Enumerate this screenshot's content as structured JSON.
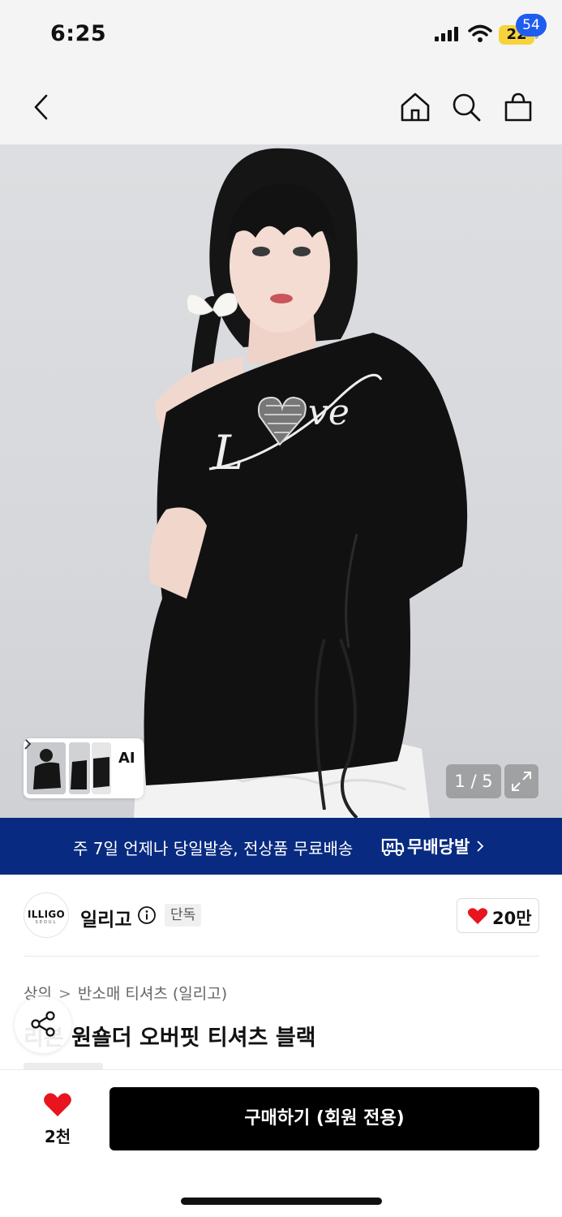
{
  "status_bar": {
    "time": "6:25",
    "battery": "22"
  },
  "nav": {
    "cart_count": "54"
  },
  "hero": {
    "counter": "1 / 5",
    "ai_label": "AI"
  },
  "banner": {
    "text": "주 7일 언제나 당일발송, 전상품 무료배송",
    "logo": "무배당발"
  },
  "brand": {
    "logo_text": "ILLIGO",
    "logo_sub": "SEOUL",
    "name": "일리고",
    "tag": "단독",
    "likes": "20만"
  },
  "product": {
    "breadcrumb": [
      "상의",
      "반소매 티셔츠 (일리고)"
    ],
    "title": "리본 원숄더 오버핏 티셔츠 블랙"
  },
  "bottom": {
    "wish_count": "2천",
    "buy_label": "구매하기 (회원 전용)"
  },
  "colors": {
    "accent_blue": "#1f5cf0",
    "banner_navy": "#082a80",
    "heart_red": "#e8141e"
  },
  "icons": [
    "back-icon",
    "home-icon",
    "search-icon",
    "cart-icon",
    "expand-icon",
    "share-icon",
    "heart-icon",
    "info-icon",
    "delivery-truck-icon"
  ]
}
